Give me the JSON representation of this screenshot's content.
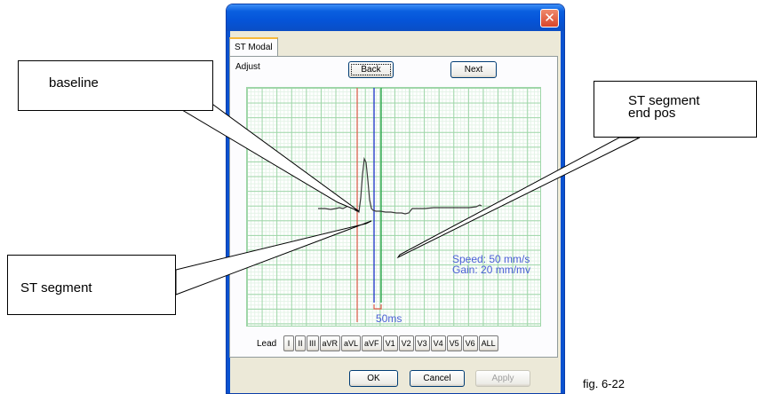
{
  "window": {
    "close_glyph": "✕",
    "tab_label": "ST Modal",
    "adjust_label": "Adjust",
    "back_button": "Back",
    "next_button": "Next",
    "ecg": {
      "speed_text": "Speed: 50 mm/s",
      "gain_text": "Gain: 20 mm/mv",
      "interval_text": "50ms",
      "colors": {
        "grid": "#9ed6a8",
        "baseline_marker": "#e05a4a",
        "st_marker": "#2a3fcc",
        "st_end_marker": "#2fa84f",
        "trace": "#3a3a3a"
      }
    },
    "lead_label": "Lead",
    "leads": [
      "I",
      "II",
      "III",
      "aVR",
      "aVL",
      "aVF",
      "V1",
      "V2",
      "V3",
      "V4",
      "V5",
      "V6",
      "ALL"
    ],
    "ok_button": "OK",
    "cancel_button": "Cancel",
    "apply_button": "Apply"
  },
  "callouts": {
    "baseline": "baseline",
    "st_segment": "ST segment",
    "st_segment_end_line1": "ST segment",
    "st_segment_end_line2": "end pos"
  },
  "figure_caption": "fig. 6-22"
}
